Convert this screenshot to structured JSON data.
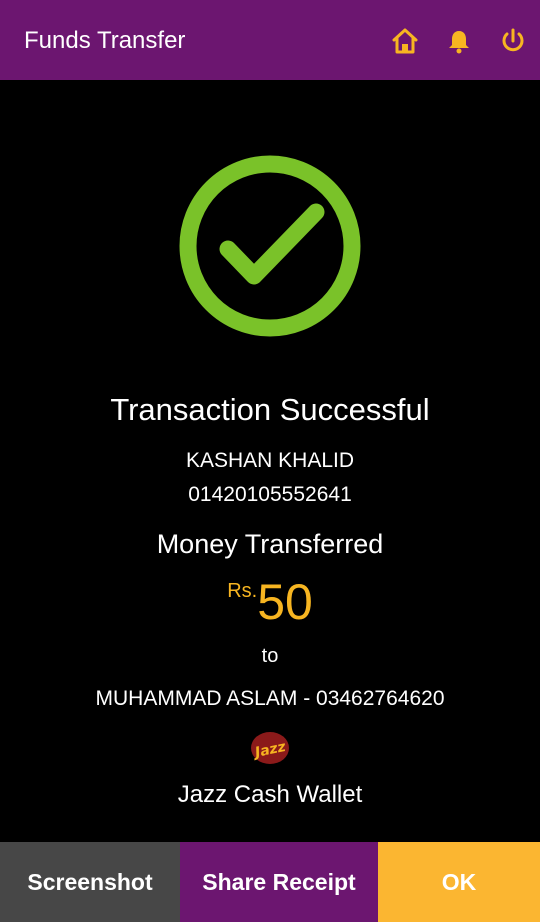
{
  "header": {
    "title": "Funds Transfer",
    "icons": [
      "home-icon",
      "bell-icon",
      "power-icon"
    ],
    "icon_color": "#f7b521",
    "background": "#6c1670"
  },
  "status": {
    "icon": "success-check-icon",
    "icon_color": "#7ac229",
    "title": "Transaction Successful"
  },
  "sender": {
    "name": "KASHAN KHALID",
    "account": "01420105552641"
  },
  "transfer": {
    "label": "Money Transferred",
    "currency": "Rs.",
    "amount": "50",
    "to_label": "to",
    "beneficiary": "MUHAMMAD ASLAM - 03462764620"
  },
  "wallet": {
    "logo": "jazz-logo",
    "name": "Jazz Cash Wallet"
  },
  "footer": {
    "screenshot_label": "Screenshot",
    "share_label": "Share Receipt",
    "ok_label": "OK"
  }
}
